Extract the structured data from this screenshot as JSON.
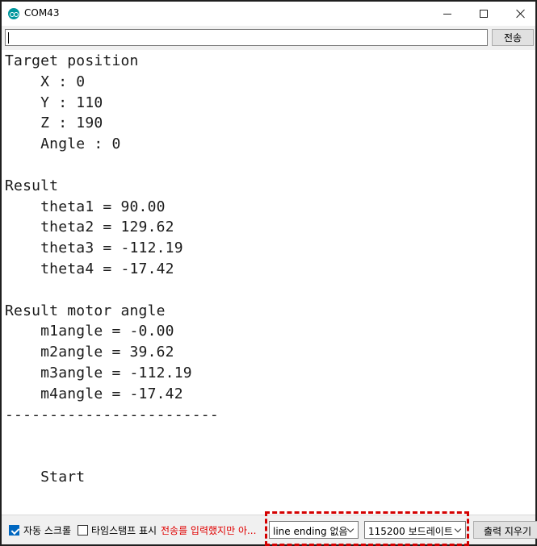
{
  "window": {
    "title": "COM43",
    "icon": "arduino-icon",
    "controls": {
      "minimize": "minimize-icon",
      "maximize": "maximize-icon",
      "close": "close-icon"
    }
  },
  "send_bar": {
    "input_value": "",
    "send_label": "전송"
  },
  "output_lines": [
    "Target position",
    "    X : 0",
    "    Y : 110",
    "    Z : 190",
    "    Angle : 0",
    "",
    "Result",
    "    theta1 = 90.00",
    "    theta2 = 129.62",
    "    theta3 = -112.19",
    "    theta4 = -17.42",
    "",
    "Result motor angle",
    "    m1angle = -0.00",
    "    m2angle = 39.62",
    "    m3angle = -112.19",
    "    m4angle = -17.42",
    "------------------------",
    "",
    "",
    "    Start",
    "",
    "------------------------"
  ],
  "bottom_bar": {
    "autoscroll_label": "자동 스크롤",
    "autoscroll_checked": true,
    "timestamp_label": "타임스탬프 표시",
    "timestamp_checked": false,
    "warning_text": "전송를 입력했지만 아...",
    "line_ending_value": "line ending 없음",
    "baud_value": "115200 보드레이트",
    "clear_label": "출력 지우기"
  },
  "colors": {
    "accent": "#0067c0",
    "warning": "#e00000",
    "highlight": "#d40000",
    "arduino": "#00979d"
  }
}
